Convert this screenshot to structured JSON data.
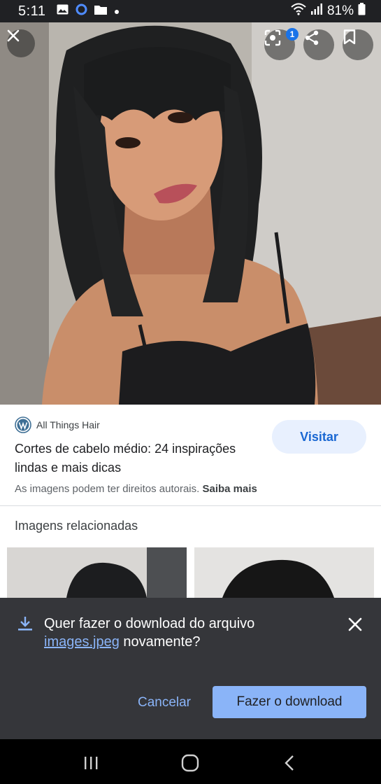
{
  "status_bar": {
    "time": "5:11",
    "battery": "81%",
    "icons": [
      "gallery-icon",
      "messenger-icon",
      "folder-icon",
      "dot-icon",
      "wifi-icon",
      "signal-icon",
      "battery-icon"
    ]
  },
  "viewer": {
    "lens_badge": "1",
    "icons": [
      "close-icon",
      "lens-icon",
      "share-icon",
      "bookmark-icon"
    ]
  },
  "result": {
    "source_name": "All Things Hair",
    "visit_label": "Visitar",
    "title": "Cortes de cabelo médio: 24 inspirações lindas e mais dicas",
    "copyright_text": "As imagens podem ter direitos autorais.",
    "learn_more": "Saiba mais"
  },
  "related": {
    "heading": "Imagens relacionadas"
  },
  "download_prompt": {
    "text_before": "Quer fazer o download do arquivo",
    "filename": "images.jpeg",
    "text_after": "novamente?",
    "cancel_label": "Cancelar",
    "confirm_label": "Fazer o download"
  },
  "colors": {
    "accent": "#8ab4f8",
    "visit_bg": "#e8f0fe",
    "visit_text": "#1967d2",
    "prompt_bg": "#35363a"
  }
}
